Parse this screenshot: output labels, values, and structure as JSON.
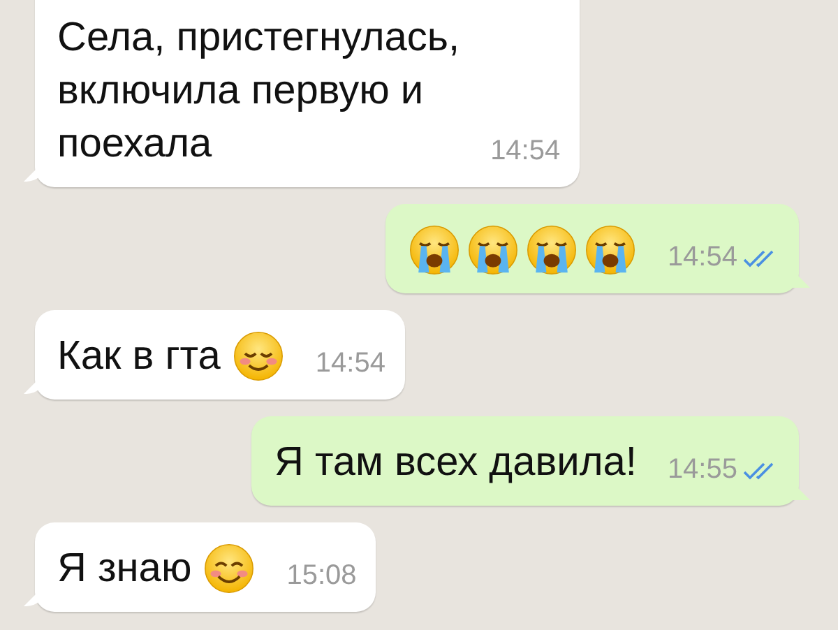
{
  "messages": [
    {
      "kind": "incoming",
      "lines": [
        "Села, пристегнулась,",
        "включила первую и",
        "поехала"
      ],
      "time": "14:54"
    },
    {
      "kind": "outgoing",
      "emojis": [
        {
          "kind": "crying"
        },
        {
          "kind": "crying"
        },
        {
          "kind": "crying"
        },
        {
          "kind": "crying"
        }
      ],
      "time": "14:54",
      "read": true
    },
    {
      "kind": "incoming",
      "lines": [
        "Как в гта"
      ],
      "emojis": [
        {
          "kind": "relieved"
        }
      ],
      "time": "14:54"
    },
    {
      "kind": "outgoing",
      "lines": [
        "Я там всех давила!"
      ],
      "time": "14:55",
      "read": true
    },
    {
      "kind": "incoming",
      "lines": [
        "Я знаю"
      ],
      "emojis": [
        {
          "kind": "smiling"
        }
      ],
      "time": "15:08"
    }
  ]
}
